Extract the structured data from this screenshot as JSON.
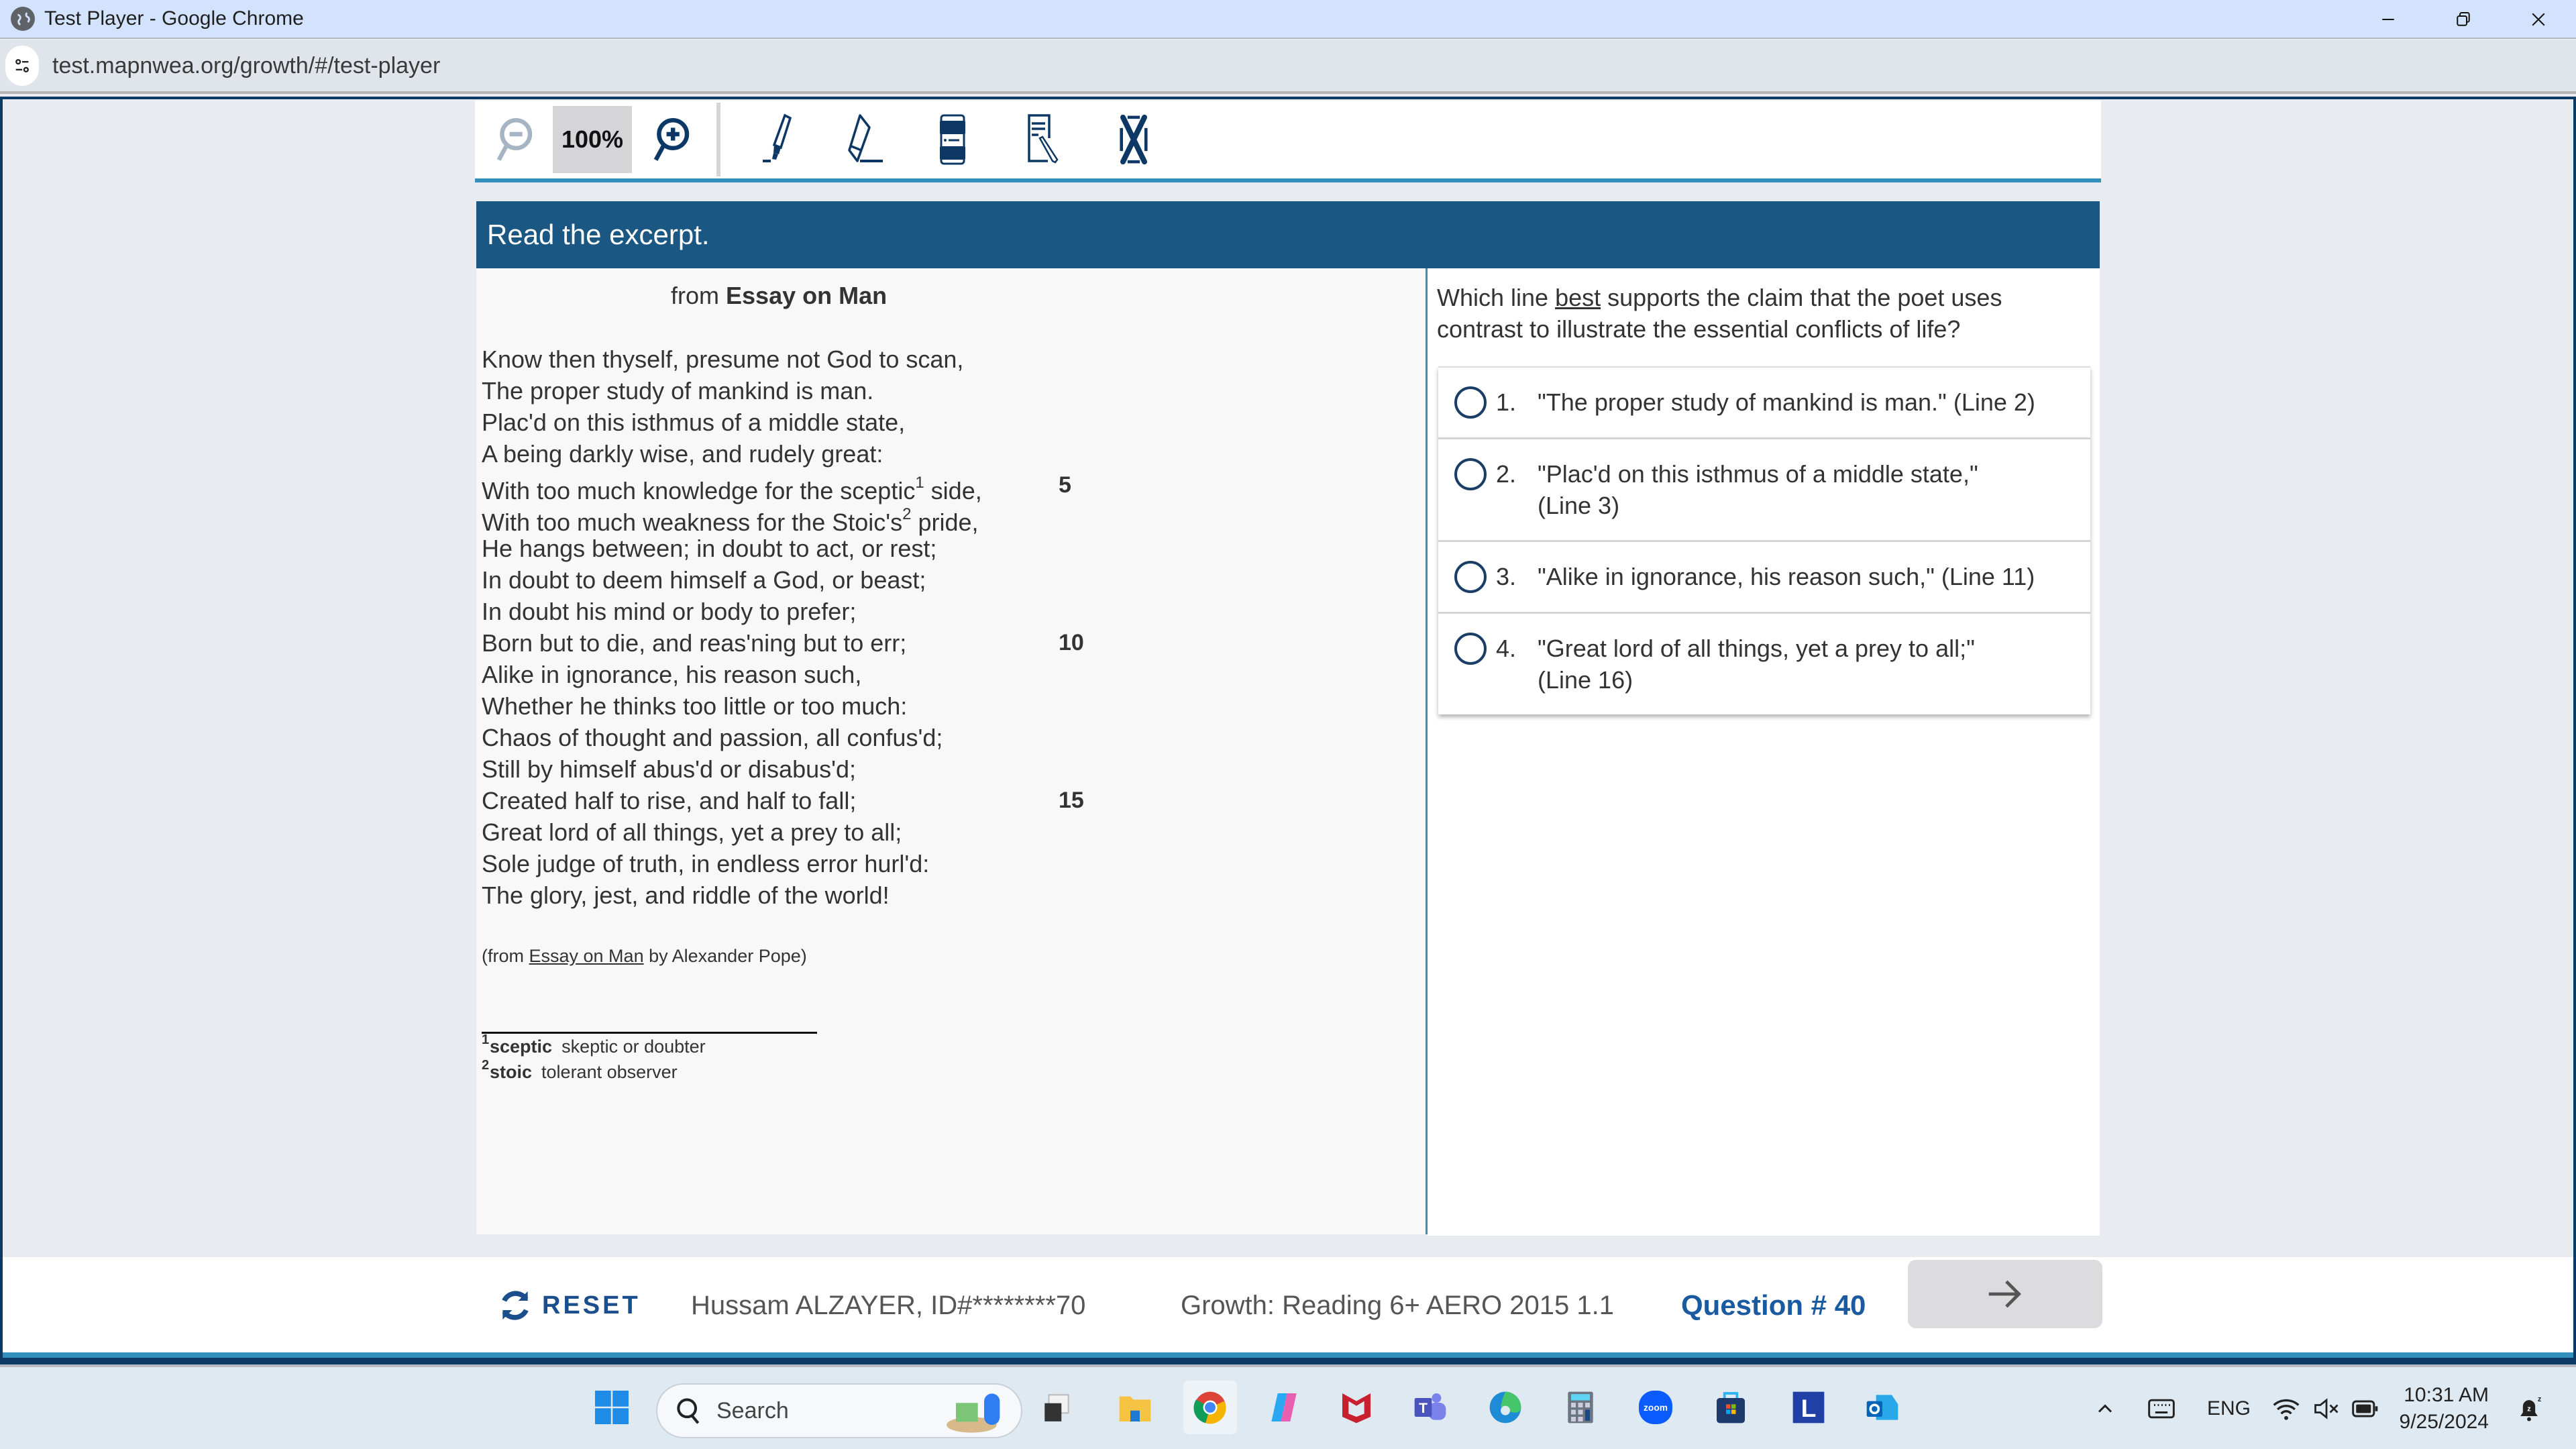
{
  "window": {
    "title": "Test Player - Google Chrome",
    "url": "test.mapnwea.org/growth/#/test-player"
  },
  "toolbar": {
    "zoom_level": "100%",
    "tools": [
      "zoom-out",
      "zoom-in",
      "highlighter",
      "eraser",
      "line-reader",
      "notepad",
      "answer-eliminator"
    ]
  },
  "header": {
    "instruction": "Read the excerpt."
  },
  "passage": {
    "title_prefix": "from",
    "title": "Essay on Man",
    "lines": [
      {
        "text": "Know then thyself, presume not God to scan,",
        "num": ""
      },
      {
        "text": "The proper study of mankind is man.",
        "num": ""
      },
      {
        "text": "Plac'd on this isthmus of a middle state,",
        "num": ""
      },
      {
        "text": "A being darkly wise, and rudely great:",
        "num": ""
      },
      {
        "text_a": "With too much knowledge for the sceptic",
        "sup": "1",
        "text_b": " side,",
        "num": "5"
      },
      {
        "text_a": "With too much weakness for the Stoic's",
        "sup": "2",
        "text_b": " pride,",
        "num": ""
      },
      {
        "text": "He hangs between; in doubt to act, or rest;",
        "num": ""
      },
      {
        "text": "In doubt to deem himself a God, or beast;",
        "num": ""
      },
      {
        "text": "In doubt his mind or body to prefer;",
        "num": ""
      },
      {
        "text": "Born but to die, and reas'ning but to err;",
        "num": "10"
      },
      {
        "text": "Alike in ignorance, his reason such,",
        "num": ""
      },
      {
        "text": "Whether he thinks too little or too much:",
        "num": ""
      },
      {
        "text": "Chaos of thought and passion, all confus'd;",
        "num": ""
      },
      {
        "text": "Still by himself abus'd or disabus'd;",
        "num": ""
      },
      {
        "text": "Created half to rise, and half to fall;",
        "num": "15"
      },
      {
        "text": "Great lord of all things, yet a prey to all;",
        "num": ""
      },
      {
        "text": "Sole judge of truth, in endless error hurl'd:",
        "num": ""
      },
      {
        "text": "The glory, jest, and riddle of the world!",
        "num": ""
      }
    ],
    "source_prefix": "(from ",
    "source_title": "Essay on Man",
    "source_suffix": " by Alexander Pope)",
    "footnotes": [
      {
        "num": "1",
        "term": "sceptic",
        "def": "skeptic or doubter"
      },
      {
        "num": "2",
        "term": "stoic",
        "def": "tolerant observer"
      }
    ]
  },
  "question": {
    "stem_a": "Which line ",
    "stem_emph": "best",
    "stem_b": " supports the claim that the poet uses contrast to illustrate the essential conflicts of life?",
    "choices": [
      {
        "num": "1.",
        "text": "\"The proper study of mankind is man.\" (Line 2)",
        "selected": false
      },
      {
        "num": "2.",
        "text": "\"Plac'd on this isthmus of a middle state,\" (Line 3)",
        "selected": false
      },
      {
        "num": "3.",
        "text": "\"Alike in ignorance, his reason such,\" (Line 11)",
        "selected": false
      },
      {
        "num": "4.",
        "text": "\"Great lord of all things, yet a prey to all;\" (Line 16)",
        "selected": false
      }
    ]
  },
  "footer": {
    "reset_label": "RESET",
    "student": "Hussam ALZAYER, ID#********70",
    "test_name": "Growth: Reading 6+ AERO 2015 1.1",
    "question_number": "Question # 40",
    "next_icon": "arrow-right"
  },
  "taskbar": {
    "search_placeholder": "Search",
    "apps": [
      "start",
      "task-view",
      "file-explorer",
      "chrome",
      "copilot",
      "mcafee",
      "teams",
      "edge",
      "calculator",
      "zoom",
      "store",
      "l-app",
      "outlook"
    ],
    "zoom_app_label": "zoom",
    "l_app_label": "L",
    "language": "ENG",
    "time": "10:31 AM",
    "date": "9/25/2024"
  },
  "colors": {
    "header_bg": "#1a5782",
    "accent_blue": "#338fbb",
    "icon_navy": "#0d3866",
    "question_number": "#1a5aa0"
  }
}
